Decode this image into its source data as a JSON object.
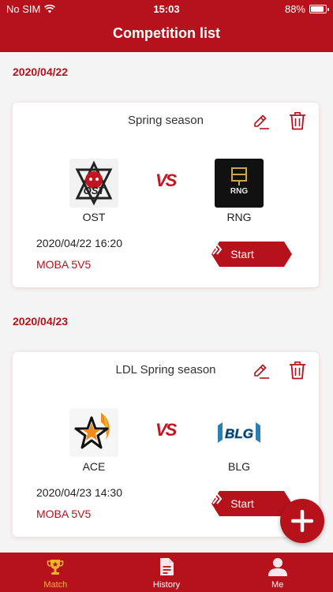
{
  "status_bar": {
    "carrier": "No SIM",
    "time": "15:03",
    "battery": "88%",
    "battery_level": 0.88
  },
  "header": {
    "title": "Competition list"
  },
  "groups": [
    {
      "date": "2020/04/22",
      "card": {
        "title": "Spring season",
        "team_left": "OST",
        "team_right": "RNG",
        "vs": "VS",
        "time": "2020/04/22 16:20",
        "type": "MOBA 5V5",
        "start_label": "Start"
      }
    },
    {
      "date": "2020/04/23",
      "card": {
        "title": "LDL Spring season",
        "team_left": "ACE",
        "team_right": "BLG",
        "vs": "VS",
        "time": "2020/04/23 14:30",
        "type": "MOBA 5V5",
        "start_label": "Start"
      }
    }
  ],
  "logos": {
    "ost": "OST",
    "rng": "RNG",
    "blg": "BLG"
  },
  "tabs": [
    {
      "label": "Match",
      "icon": "trophy-icon",
      "active": true
    },
    {
      "label": "History",
      "icon": "document-icon",
      "active": false
    },
    {
      "label": "Me",
      "icon": "person-icon",
      "active": false
    }
  ],
  "colors": {
    "primary": "#b5121b",
    "active_tab": "#f0b233",
    "background": "#f4f4f4"
  }
}
